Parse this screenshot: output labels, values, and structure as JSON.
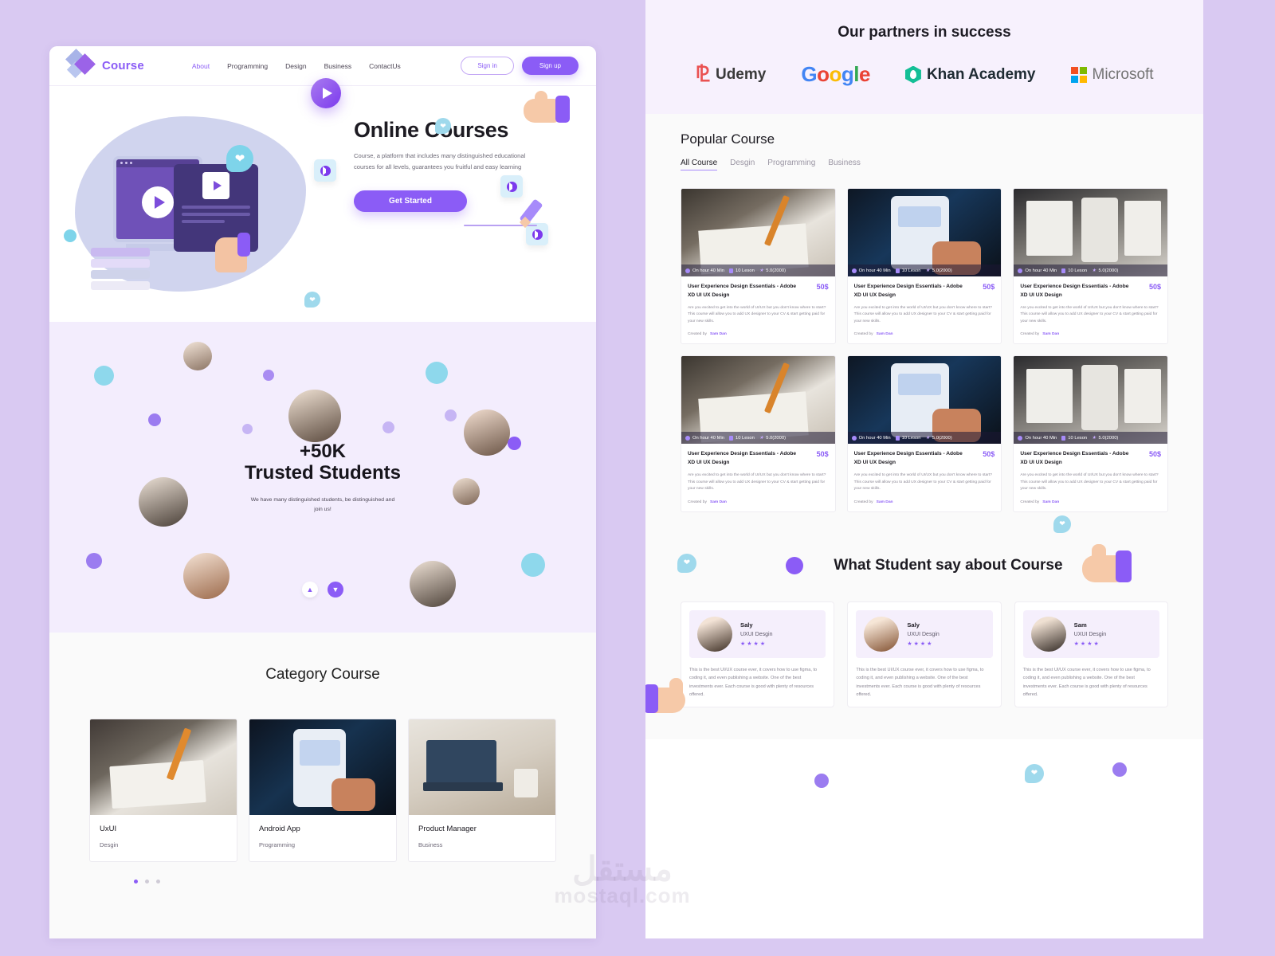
{
  "brand": {
    "name": "Course"
  },
  "nav": {
    "links": [
      "About",
      "Programming",
      "Design",
      "Business",
      "ContactUs"
    ],
    "active_link": "About",
    "signin_label": "Sign in",
    "signup_label": "Sign up"
  },
  "hero": {
    "title": "Online Courses",
    "subtitle": "Course, a platform that includes many distinguished educational courses for all levels, guarantees you fruitful and easy learning",
    "cta_label": "Get Started"
  },
  "students": {
    "count": "+50K",
    "label": "Trusted Students",
    "description": "We have many distinguished students, be distinguished and join us!",
    "up_arrow": "▲",
    "down_arrow": "▼"
  },
  "category": {
    "title": "Category Course",
    "cards": [
      {
        "name": "UxUI",
        "tag": "Desgin"
      },
      {
        "name": "Android App",
        "tag": "Programming"
      },
      {
        "name": "Product Manager",
        "tag": "Business"
      }
    ],
    "dots": 3,
    "active_dot": 1
  },
  "partners": {
    "title": "Our partners in success",
    "logos": [
      {
        "name": "Udemy",
        "mark": "udemy-logo"
      },
      {
        "name": "Google",
        "mark": "google-logo"
      },
      {
        "name": "Khan Academy",
        "mark": "khan-academy-logo"
      },
      {
        "name": "Microsoft",
        "mark": "microsoft-logo"
      }
    ],
    "google_letters": [
      {
        "c": "G",
        "color": "#4285F4"
      },
      {
        "c": "o",
        "color": "#EA4335"
      },
      {
        "c": "o",
        "color": "#FBBC05"
      },
      {
        "c": "g",
        "color": "#4285F4"
      },
      {
        "c": "l",
        "color": "#34A853"
      },
      {
        "c": "e",
        "color": "#EA4335"
      }
    ],
    "microsoft_squares": [
      "#F25022",
      "#7FBA00",
      "#00A4EF",
      "#FFB900"
    ]
  },
  "popular": {
    "title": "Popular Course",
    "tabs": [
      "All Course",
      "Desgin",
      "Programming",
      "Business"
    ],
    "active_tab": "All Course",
    "courses": [
      {
        "duration": "On hour 40 Min",
        "lessons": "10 Leson",
        "rating": "5.0(2000)",
        "title": "User Experience Design Essentials - Adobe XD UI UX Design",
        "price": "50$",
        "desc": "Are you excited to get into the world of UI/UX but you don't know where to start? This course will allow you to add UX designer to your CV & start getting paid for your new skills.",
        "created_label": "Created by",
        "author": "Sam Dan",
        "thumb": "sketch-wireframe"
      },
      {
        "duration": "On hour 40 Min",
        "lessons": "10 Leson",
        "rating": "5.0(2000)",
        "title": "User Experience Design Essentials - Adobe XD UI UX Design",
        "price": "50$",
        "desc": "Are you excited to get into the world of UI/UX but you don't know where to start? This course will allow you to add UX designer to your CV & start getting paid for your new skills.",
        "created_label": "Created by",
        "author": "Sam Dan",
        "thumb": "phone-hand"
      },
      {
        "duration": "On hour 40 Min",
        "lessons": "10 Leson",
        "rating": "5.0(2000)",
        "title": "User Experience Design Essentials - Adobe XD UI UX Design",
        "price": "50$",
        "desc": "Are you excited to get into the world of UI/UX but you don't know where to start? This course will allow you to add UX designer to your CV & start getting paid for your new skills.",
        "created_label": "Created by",
        "author": "Sam Dan",
        "thumb": "screens-desk"
      },
      {
        "duration": "On hour 40 Min",
        "lessons": "10 Leson",
        "rating": "5.0(2000)",
        "title": "User Experience Design Essentials - Adobe XD UI UX Design",
        "price": "50$",
        "desc": "Are you excited to get into the world of UI/UX but you don't know where to start? This course will allow you to add UX designer to your CV & start getting paid for your new skills.",
        "created_label": "Created by",
        "author": "Sam Dan",
        "thumb": "sketch-wireframe"
      },
      {
        "duration": "On hour 40 Min",
        "lessons": "10 Leson",
        "rating": "5.0(2000)",
        "title": "User Experience Design Essentials - Adobe XD UI UX Design",
        "price": "50$",
        "desc": "Are you excited to get into the world of UI/UX but you don't know where to start? This course will allow you to add UX designer to your CV & start getting paid for your new skills.",
        "created_label": "Created by",
        "author": "Sam Dan",
        "thumb": "phone-hand"
      },
      {
        "duration": "On hour 40 Min",
        "lessons": "10 Leson",
        "rating": "5.0(2000)",
        "title": "User Experience Design Essentials - Adobe XD UI UX Design",
        "price": "50$",
        "desc": "Are you excited to get into the world of UI/UX but you don't know where to start? This course will allow you to add UX designer to your CV & start getting paid for your new skills.",
        "created_label": "Created by",
        "author": "Sam Dan",
        "thumb": "screens-desk"
      }
    ]
  },
  "testimonials": {
    "title": "What Student say about Course",
    "cards": [
      {
        "name": "Saly",
        "role": "UXUI Desgin",
        "stars": "★★★★",
        "text": "This is the best UI/UX course ever, it covers how to use figma, to coding it, and even publishing a website. One of the best investments ever.\nEach course is good with plenty of resources offered."
      },
      {
        "name": "Saly",
        "role": "UXUI Desgin",
        "stars": "★★★★",
        "text": "This is the best UI/UX course ever, it covers how to use figma, to coding it, and even publishing a website. One of the best investments ever.\nEach course is good with plenty of resources offered."
      },
      {
        "name": "Sam",
        "role": "UXUI Desgin",
        "stars": "★★★★",
        "text": "This is the best UI/UX course ever, it covers how to use figma, to coding it, and even publishing a website. One of the best investments ever.\nEach course is good with plenty of resources offered."
      }
    ]
  },
  "watermark": {
    "arabic": "مستقل",
    "latin": "mostaql.com"
  },
  "colors": {
    "accent": "#8b5cf6",
    "page_bg": "#d9c9f2",
    "soft_lavender": "#f3edfd",
    "partners_bg": "#f7f1fd"
  }
}
